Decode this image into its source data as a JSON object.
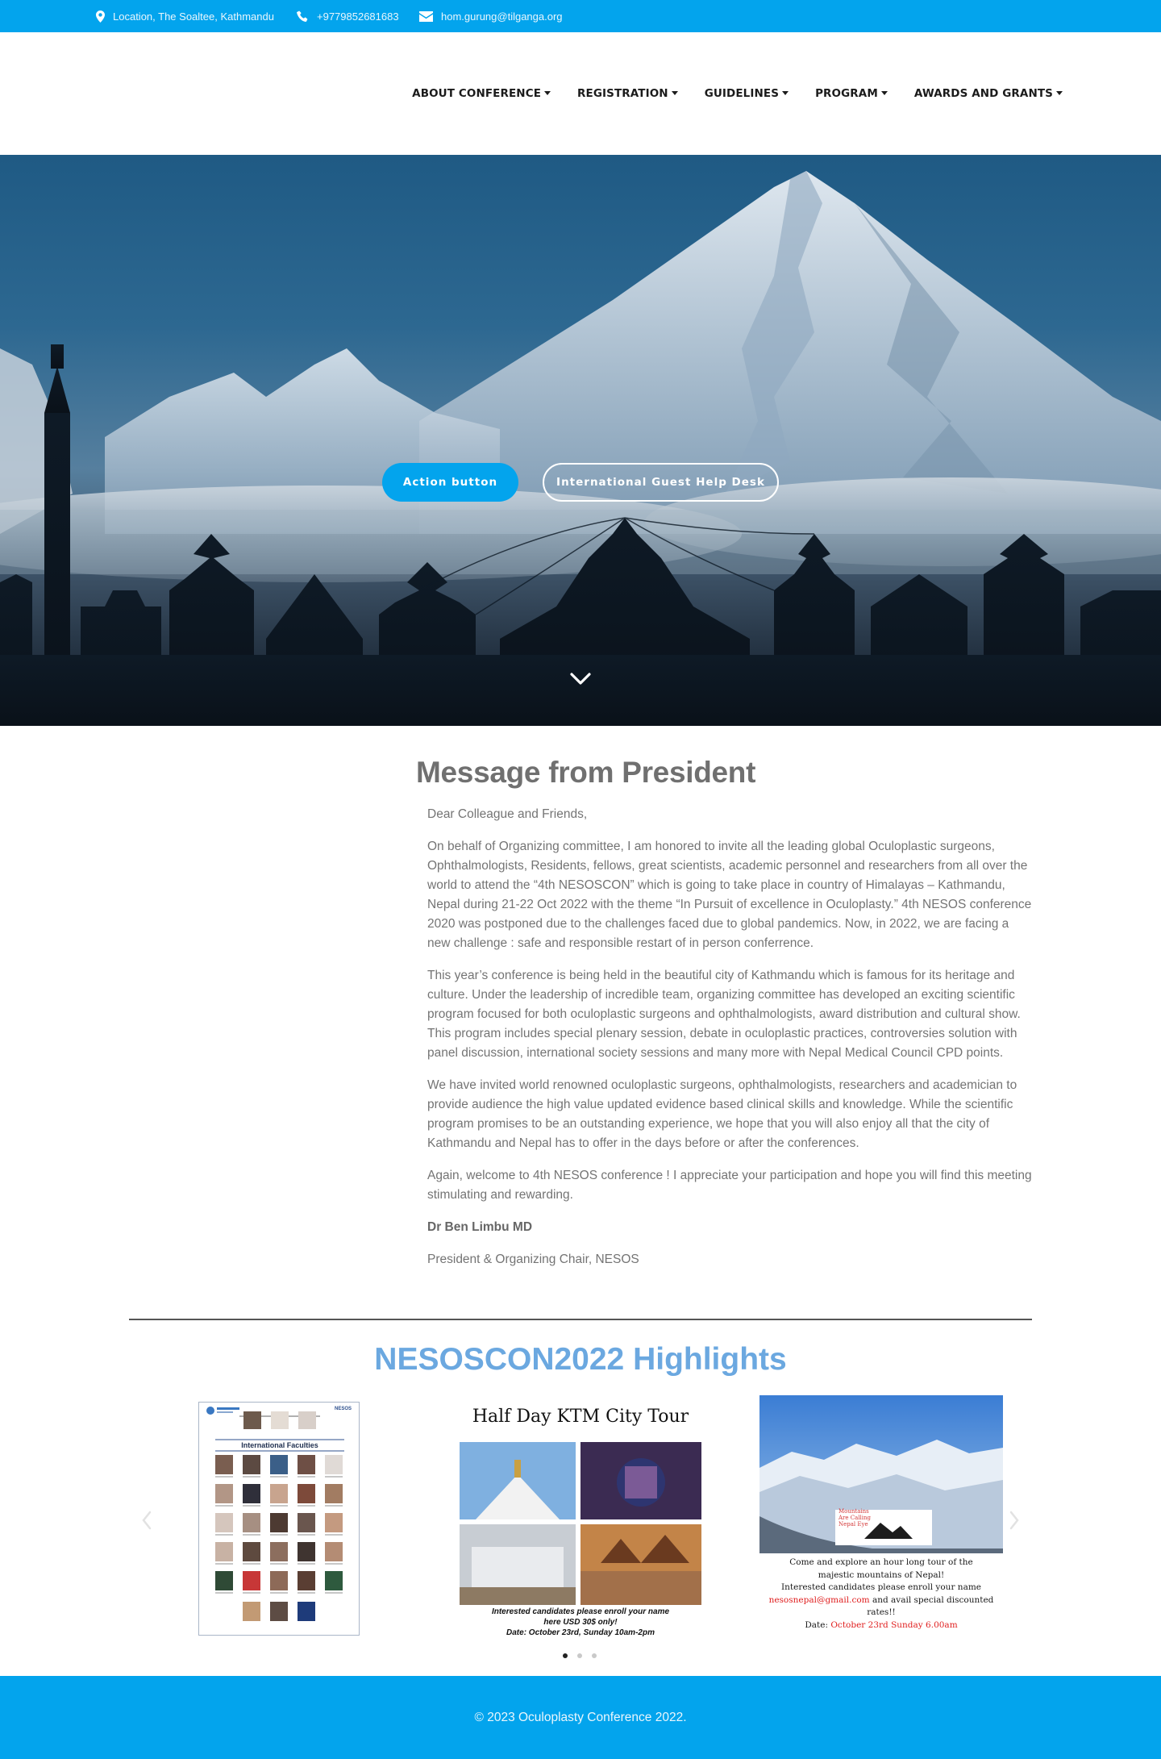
{
  "topbar": {
    "location": "Location, The Soaltee, Kathmandu",
    "phone": "+9779852681683",
    "email": "hom.gurung@tilganga.org"
  },
  "nav": {
    "items": [
      {
        "label": "ABOUT CONFERENCE"
      },
      {
        "label": "REGISTRATION"
      },
      {
        "label": "GUIDELINES"
      },
      {
        "label": "PROGRAM"
      },
      {
        "label": "AWARDS AND GRANTS"
      }
    ]
  },
  "hero": {
    "primary_button": "Action button",
    "secondary_button": "International Guest Help Desk"
  },
  "message": {
    "title": "Message from President",
    "greeting": "Dear Colleague and Friends,",
    "paragraphs": [
      "On behalf of Organizing committee, I am honored to invite all the leading global Oculoplastic surgeons, Ophthalmologists, Residents, fellows, great scientists, academic personnel and researchers from all over the world to attend the “4th NESOSCON” which is going to take place in country of Himalayas – Kathmandu, Nepal during 21-22 Oct 2022 with the theme “In Pursuit of excellence in Oculoplasty.” 4th NESOS conference 2020 was postponed due to the challenges faced due to global pandemics. Now, in 2022, we are facing a new challenge : safe and responsible restart of in person conferrence.",
      "This year’s conference is being held in the beautiful city of Kathmandu which is famous for its heritage and culture. Under the leadership of incredible team, organizing committee has developed an exciting scientific program focused for both oculoplastic surgeons and ophthalmologists, award distribution and cultural show. This program includes special plenary session, debate in oculoplastic practices, controversies solution with panel discussion,  international society sessions and many more with Nepal Medical Council CPD points.",
      "We have invited world renowned oculoplastic surgeons, ophthalmologists, researchers and academician to provide audience the high value updated evidence based clinical skills and knowledge. While the scientific program promises to be an outstanding experience, we hope that you will also enjoy all that the city of Kathmandu and Nepal has to offer in the days before or after the conferences.",
      "Again, welcome to 4th NESOS conference ! I appreciate your participation and hope you will find this meeting stimulating and rewarding."
    ],
    "signature_name": "Dr Ben Limbu MD",
    "signature_role": "President & Organizing Chair, NESOS"
  },
  "highlights": {
    "title": "NESOSCON2022 Highlights",
    "slide1": {
      "brand": "NESOS",
      "heading": "International Faculties"
    },
    "slide2": {
      "title": "Half Day KTM City Tour",
      "caption_lines": [
        "Interested candidates please enroll your name",
        "here  USD 30$ only!",
        "Date: October 23rd, Sunday  10am-2pm"
      ]
    },
    "slide3": {
      "logo_lines": [
        "Mountains",
        "Are Calling",
        "Nepal Eye"
      ],
      "lines": [
        "Come and explore an hour long tour of the",
        "majestic mountains of Nepal!",
        "Interested candidates please enroll your name",
        "and avail special discounted",
        "rates!!"
      ],
      "email": "nesosnepal@gmail.com",
      "date_prefix": "Date: ",
      "date": "October 23rd Sunday 6.00am"
    },
    "active_index": 0,
    "slide_count": 3
  },
  "footer": {
    "copyright": "© 2023 Oculoplasty Conference 2022."
  },
  "colors": {
    "primary": "#03a4ed",
    "heading_blue": "#6ba8e0",
    "text_gray": "#747474"
  }
}
